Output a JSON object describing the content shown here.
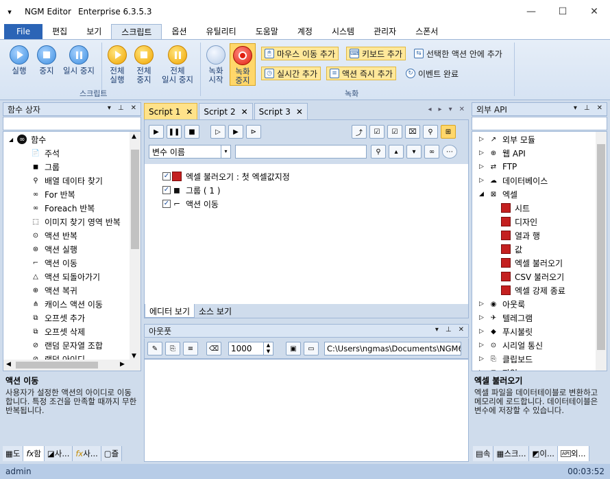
{
  "window": {
    "app_name": "NGM Editor",
    "edition": "Enterprise 6.3.5.3",
    "minimize": "—",
    "maximize": "☐",
    "close": "✕"
  },
  "menu": {
    "file": "File",
    "items": [
      "편집",
      "보기",
      "스크립트",
      "옵션",
      "유틸리티",
      "도움말",
      "계정",
      "시스템",
      "관리자",
      "스폰서"
    ],
    "active_index": 2
  },
  "ribbon": {
    "script_group": {
      "label": "스크립트",
      "run": "실행",
      "stop": "중지",
      "pause": "일시 중지",
      "all_run": [
        "전체",
        "실행"
      ],
      "all_stop": [
        "전체",
        "중지"
      ],
      "all_pause": [
        "전체",
        "일시 중지"
      ]
    },
    "record_group": {
      "label": "녹화",
      "start": [
        "녹화",
        "시작"
      ],
      "stop": [
        "녹화",
        "중지"
      ],
      "add_mouse": "마우스 이동 추가",
      "add_keyboard": "키보드 추가",
      "add_in_action": "선택한 액션 안에 추가",
      "add_realtime": "실시간 추가",
      "add_instant": "액션 즉시 추가",
      "event_done": "이벤트 완료"
    }
  },
  "left_panel": {
    "title": "함수 상자",
    "root": "함수",
    "items": [
      "주석",
      "그룹",
      "배열 데이타 찾기",
      "For 반복",
      "Foreach 반복",
      "이미지 찾기 영역 반복",
      "액션 반복",
      "액션 실행",
      "액션 이동",
      "액션 되돌아가기",
      "액션 복귀",
      "캐이스 액션 이동",
      "오프셋 추가",
      "오프셋 삭제",
      "랜덤 문자열 조합",
      "랜덤 아이디"
    ],
    "desc_title": "액션 이동",
    "desc": "사용자가 설정한 액션의 아이디로 이동합니다. 특정 조건을 만족할 때까지 무한 반복됩니다.",
    "tabs": [
      "도",
      "함",
      "사...",
      "사...",
      "즐"
    ]
  },
  "editor": {
    "tabs": [
      "Script 1",
      "Script 2",
      "Script 3"
    ],
    "active_tab": 0,
    "var_select": "변수 이름",
    "search_value": "",
    "rows": [
      {
        "label": "엑셀 불러오기 : 첫 엑셀값지정",
        "checked": true,
        "icon": "excel-icon"
      },
      {
        "label": "그룹 ( 1 )",
        "checked": true,
        "icon": "group-icon"
      },
      {
        "label": "액션 이동",
        "checked": true,
        "icon": "action-move-icon"
      }
    ],
    "bottom_tabs": [
      "에디터 보기",
      "소스 보기"
    ]
  },
  "output": {
    "title": "아웃풋",
    "interval": "1000",
    "path": "C:\\Users\\ngmas\\Documents\\NGM6\\"
  },
  "right_panel": {
    "title": "외부 API",
    "items": [
      {
        "label": "외부 모듈",
        "level": 0,
        "expand": "▷"
      },
      {
        "label": "웹 API",
        "level": 0,
        "expand": "▷"
      },
      {
        "label": "FTP",
        "level": 0,
        "expand": "▷"
      },
      {
        "label": "데이터베이스",
        "level": 0,
        "expand": "▷"
      },
      {
        "label": "엑셀",
        "level": 0,
        "expand": "◢"
      },
      {
        "label": "시트",
        "level": 1,
        "expand": ""
      },
      {
        "label": "디자인",
        "level": 1,
        "expand": ""
      },
      {
        "label": "열과 행",
        "level": 1,
        "expand": ""
      },
      {
        "label": "값",
        "level": 1,
        "expand": ""
      },
      {
        "label": "엑셀 불러오기",
        "level": 1,
        "expand": ""
      },
      {
        "label": "CSV 불러오기",
        "level": 1,
        "expand": ""
      },
      {
        "label": "엑셀 강제 종료",
        "level": 1,
        "expand": ""
      },
      {
        "label": "아웃룩",
        "level": 0,
        "expand": "▷"
      },
      {
        "label": "텔레그램",
        "level": 0,
        "expand": "▷"
      },
      {
        "label": "푸시불릿",
        "level": 0,
        "expand": "▷"
      },
      {
        "label": "시리얼 통신",
        "level": 0,
        "expand": "▷"
      },
      {
        "label": "클립보드",
        "level": 0,
        "expand": "▷"
      },
      {
        "label": "파일",
        "level": 0,
        "expand": "▷"
      }
    ],
    "desc_title": "엑셀 불러오기",
    "desc": "엑셀 파일을 데이터테이블로 변환하고 메모리에 로드합니다. 데이터테이블은 변수에 저장할 수 있습니다.",
    "tabs": [
      "속",
      "스크...",
      "이...",
      "외..."
    ]
  },
  "status": {
    "user": "admin",
    "time": "00:03:52"
  }
}
